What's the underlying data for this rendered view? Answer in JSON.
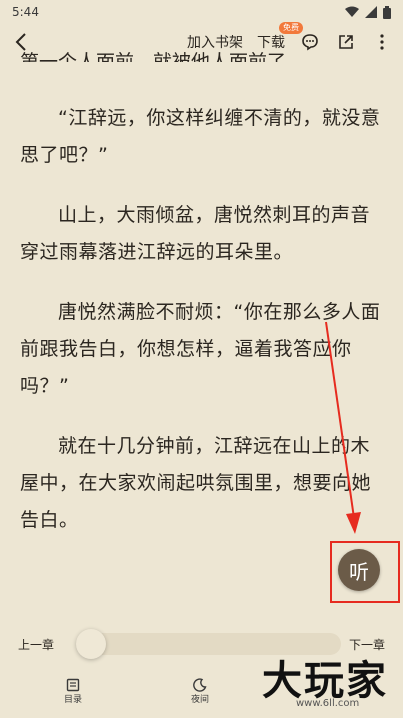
{
  "status": {
    "time": "5:44"
  },
  "top_bar": {
    "add_to_shelf": "加入书架",
    "download": "下载",
    "download_badge": "免费"
  },
  "reader": {
    "clipped_line": "第一个人面前，就被他人面前了，",
    "paragraphs": [
      "“江辞远，你这样纠缠不清的，就没意思了吧？”",
      "山上，大雨倾盆，唐悦然刺耳的声音穿过雨幕落进江辞远的耳朵里。",
      "唐悦然满脸不耐烦：“你在那么多人面前跟我告白，你想怎样，逼着我答应你吗？”",
      "就在十几分钟前，江辞远在山上的木屋中，在大家欢闹起哄氛围里，想要向她告白。"
    ]
  },
  "listen_button": {
    "label": "听"
  },
  "progress": {
    "prev": "上一章",
    "next": "下一章",
    "value": 0.0
  },
  "bottom_nav": {
    "catalog": "目录",
    "night": "夜间"
  },
  "watermark": {
    "text": "大玩家",
    "url": "www.6ll.com"
  }
}
